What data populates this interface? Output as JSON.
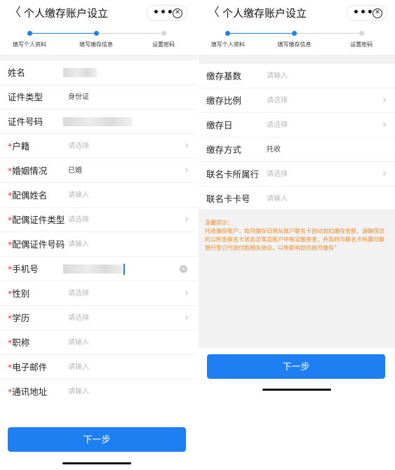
{
  "page_title": "个人缴存账户设立",
  "icons": {
    "back": "chevron-left-icon",
    "more": "more-dots-icon",
    "close": "close-circle-icon",
    "arrow": "chevron-right-icon",
    "clear": "clear-circle-icon"
  },
  "colors": {
    "accent": "#1d7ff2",
    "required": "#e53935",
    "tip_text": "#f08a24",
    "inactive_step": "#d5d5d5"
  },
  "steps": [
    "填写个人资料",
    "填写缴存信息",
    "设置密码"
  ],
  "left": {
    "current_step": 2,
    "fields": [
      {
        "label": "姓名",
        "required": false,
        "value": "",
        "placeholder": "",
        "type": "blurred"
      },
      {
        "label": "证件类型",
        "required": false,
        "value": "身份证",
        "placeholder": "",
        "type": "text"
      },
      {
        "label": "证件号码",
        "required": false,
        "value": "",
        "placeholder": "",
        "type": "blurred"
      },
      {
        "label": "户籍",
        "required": true,
        "value": "",
        "placeholder": "请选择",
        "type": "select"
      },
      {
        "label": "婚姻情况",
        "required": true,
        "value": "已婚",
        "placeholder": "",
        "type": "select"
      },
      {
        "label": "配偶姓名",
        "required": true,
        "value": "",
        "placeholder": "请输入",
        "type": "input"
      },
      {
        "label": "配偶证件类型",
        "required": true,
        "value": "",
        "placeholder": "请选择",
        "type": "select"
      },
      {
        "label": "配偶证件号码",
        "required": true,
        "value": "",
        "placeholder": "请输入",
        "type": "input"
      },
      {
        "label": "手机号",
        "required": true,
        "value": "",
        "placeholder": "",
        "type": "phone"
      },
      {
        "label": "性别",
        "required": true,
        "value": "",
        "placeholder": "请选择",
        "type": "select"
      },
      {
        "label": "学历",
        "required": true,
        "value": "",
        "placeholder": "请选择",
        "type": "select"
      },
      {
        "label": "职称",
        "required": true,
        "value": "",
        "placeholder": "请输入",
        "type": "input"
      },
      {
        "label": "电子邮件",
        "required": true,
        "value": "",
        "placeholder": "请输入",
        "type": "input"
      },
      {
        "label": "通讯地址",
        "required": true,
        "value": "",
        "placeholder": "请输入",
        "type": "input"
      }
    ],
    "next_button": "下一步"
  },
  "right": {
    "current_step": 2,
    "fields": [
      {
        "label": "缴存基数",
        "value": "",
        "placeholder": "请输入",
        "type": "input"
      },
      {
        "label": "缴存比例",
        "value": "",
        "placeholder": "请选择",
        "type": "select"
      },
      {
        "label": "缴存日",
        "value": "",
        "placeholder": "请选择",
        "type": "select"
      },
      {
        "label": "缴存方式",
        "value": "托收",
        "placeholder": "",
        "type": "text"
      },
      {
        "label": "联名卡所属行",
        "value": "",
        "placeholder": "请选择",
        "type": "select"
      },
      {
        "label": "联名卡卡号",
        "value": "",
        "placeholder": "请输入",
        "type": "input"
      }
    ],
    "tip_title": "温馨提示：",
    "tip_body": "托收缴存账户，每月缴存日将从账户联名卡自动划扣缴存金额，请确保您的公积金联名卡状态正常且账户中有足额资金，并及时与联名卡所属归集银行签订代收付款相关协议，以免影响您的按月缴存”",
    "next_button": "下一步"
  }
}
